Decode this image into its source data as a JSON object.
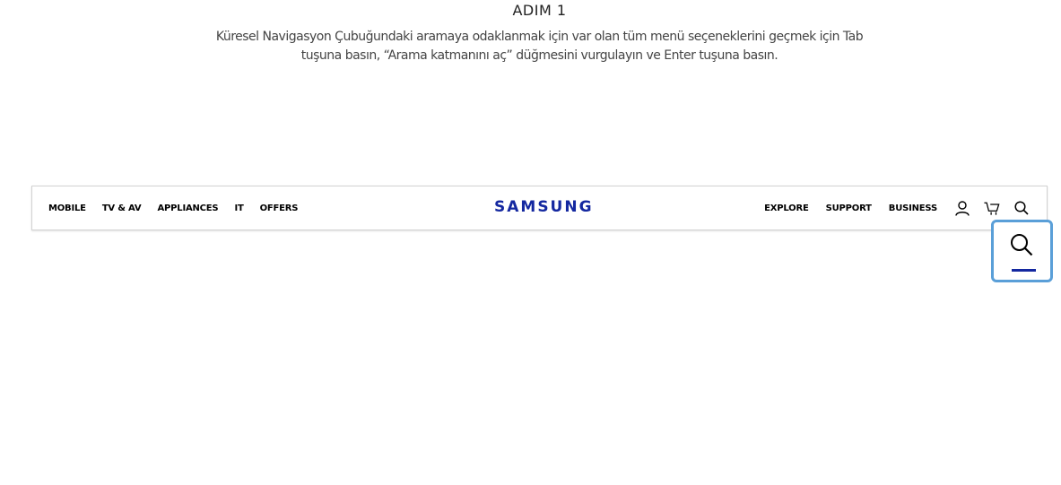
{
  "step": {
    "title": "ADIM 1",
    "description_line1": "Küresel Navigasyon Çubuğundaki aramaya odaklanmak için var olan tüm menü seçeneklerini geçmek için Tab",
    "description_line2": "tuşuna basın, “Arama katmanını aç” düğmesini vurgulayın ve Enter tuşuna basın."
  },
  "gnb": {
    "left_menu": [
      "MOBILE",
      "TV & AV",
      "APPLIANCES",
      "IT",
      "OFFERS"
    ],
    "logo": "SAMSUNG",
    "right_menu": [
      "EXPLORE",
      "SUPPORT",
      "BUSINESS"
    ],
    "icons": [
      "user-icon",
      "cart-icon",
      "search-icon"
    ]
  },
  "focus_highlight": {
    "icon": "search-icon",
    "border_color": "#5a9fd8",
    "indicator_color": "#1428a0"
  },
  "colors": {
    "brand": "#1428a0"
  }
}
